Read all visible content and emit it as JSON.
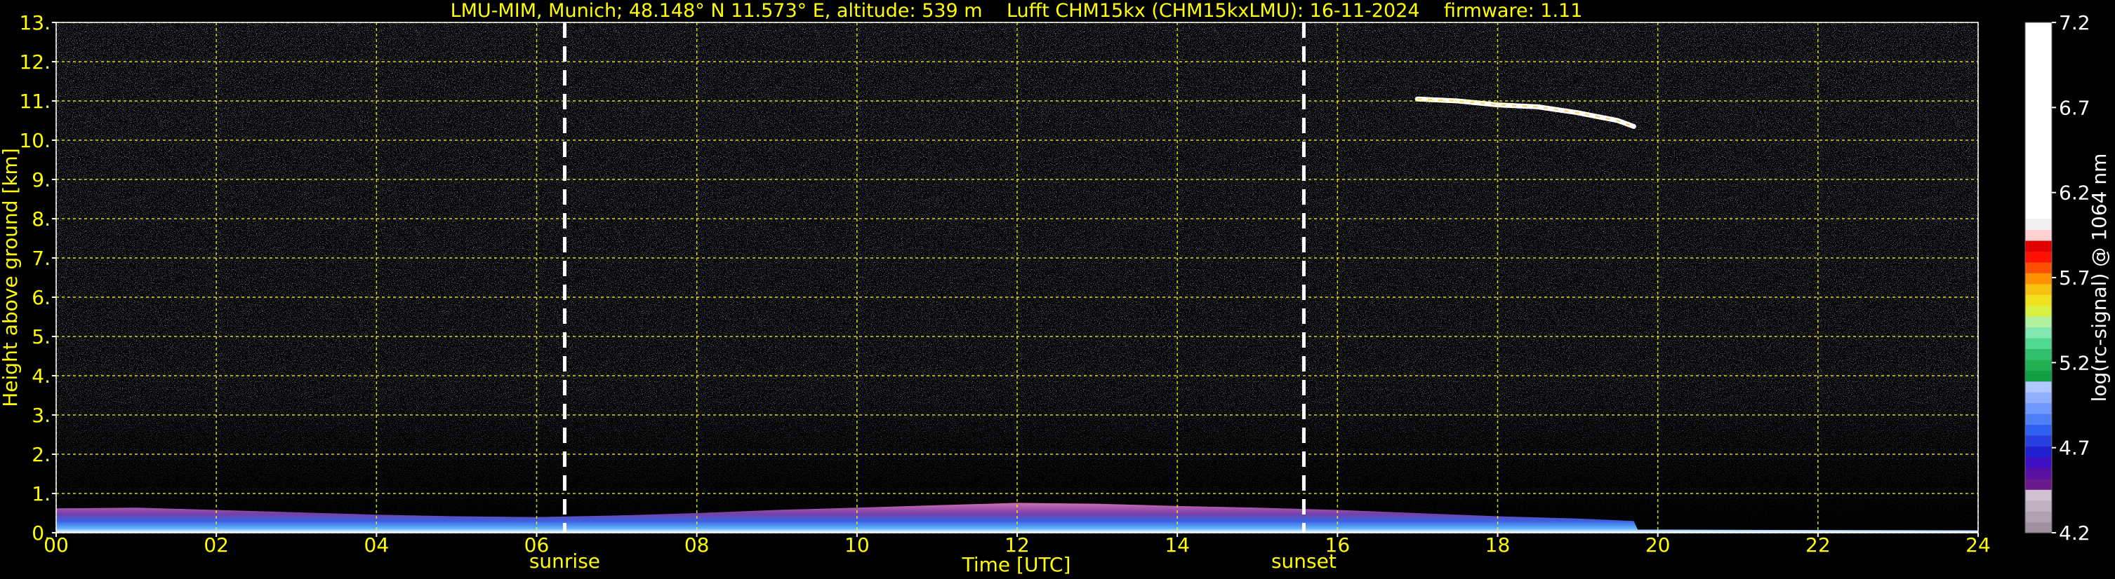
{
  "chart_data": {
    "type": "heatmap",
    "title": "LMU-MIM, Munich; 48.148° N 11.573° E, altitude: 539 m    Lufft CHM15kx (CHM15kxLMU): 16-11-2024    firmware: 1.11",
    "xlabel": "Time [UTC]",
    "ylabel": "Height above ground [km]",
    "xlim": [
      0,
      24
    ],
    "ylim": [
      0,
      13
    ],
    "x_ticks": [
      "00",
      "02",
      "04",
      "06",
      "08",
      "10",
      "12",
      "14",
      "16",
      "18",
      "20",
      "22",
      "24"
    ],
    "y_ticks": [
      "0.",
      "1.",
      "2.",
      "3.",
      "4.",
      "5.",
      "6.",
      "7.",
      "8.",
      "9.",
      "10.",
      "11.",
      "12.",
      "13."
    ],
    "grid": true,
    "colorbar": {
      "label": "log(rc-signal) @ 1064 nm",
      "range": [
        4.2,
        7.2
      ],
      "ticks": [
        "4.2",
        "4.7",
        "5.2",
        "5.7",
        "6.2",
        "6.7",
        "7.2"
      ],
      "position": "right"
    },
    "events": [
      {
        "label": "sunrise",
        "time_h": 6.35
      },
      {
        "label": "sunset",
        "time_h": 15.58
      }
    ],
    "boundary_layer": [
      {
        "t": 0.0,
        "top_km": 0.62
      },
      {
        "t": 1.0,
        "top_km": 0.64
      },
      {
        "t": 2.0,
        "top_km": 0.58
      },
      {
        "t": 3.0,
        "top_km": 0.52
      },
      {
        "t": 4.0,
        "top_km": 0.46
      },
      {
        "t": 5.0,
        "top_km": 0.42
      },
      {
        "t": 6.0,
        "top_km": 0.4
      },
      {
        "t": 7.0,
        "top_km": 0.44
      },
      {
        "t": 8.0,
        "top_km": 0.5
      },
      {
        "t": 9.0,
        "top_km": 0.58
      },
      {
        "t": 10.0,
        "top_km": 0.64
      },
      {
        "t": 11.0,
        "top_km": 0.7
      },
      {
        "t": 12.0,
        "top_km": 0.76
      },
      {
        "t": 13.0,
        "top_km": 0.74
      },
      {
        "t": 14.0,
        "top_km": 0.68
      },
      {
        "t": 15.0,
        "top_km": 0.64
      },
      {
        "t": 16.0,
        "top_km": 0.58
      },
      {
        "t": 17.0,
        "top_km": 0.5
      },
      {
        "t": 18.0,
        "top_km": 0.42
      },
      {
        "t": 19.0,
        "top_km": 0.36
      },
      {
        "t": 19.7,
        "top_km": 0.3
      },
      {
        "t": 19.75,
        "top_km": 0.08
      },
      {
        "t": 24.0,
        "top_km": 0.06
      }
    ],
    "cirrus_layer": [
      {
        "t": 17.0,
        "km": 11.05
      },
      {
        "t": 17.5,
        "km": 11.0
      },
      {
        "t": 18.0,
        "km": 10.9
      },
      {
        "t": 18.5,
        "km": 10.85
      },
      {
        "t": 19.0,
        "km": 10.7
      },
      {
        "t": 19.5,
        "km": 10.5
      },
      {
        "t": 19.7,
        "km": 10.35
      }
    ],
    "colors": {
      "background": "#000000",
      "axis_text": "#ffff00",
      "grid": "#ffff00",
      "event_line": "#ffffff"
    }
  }
}
